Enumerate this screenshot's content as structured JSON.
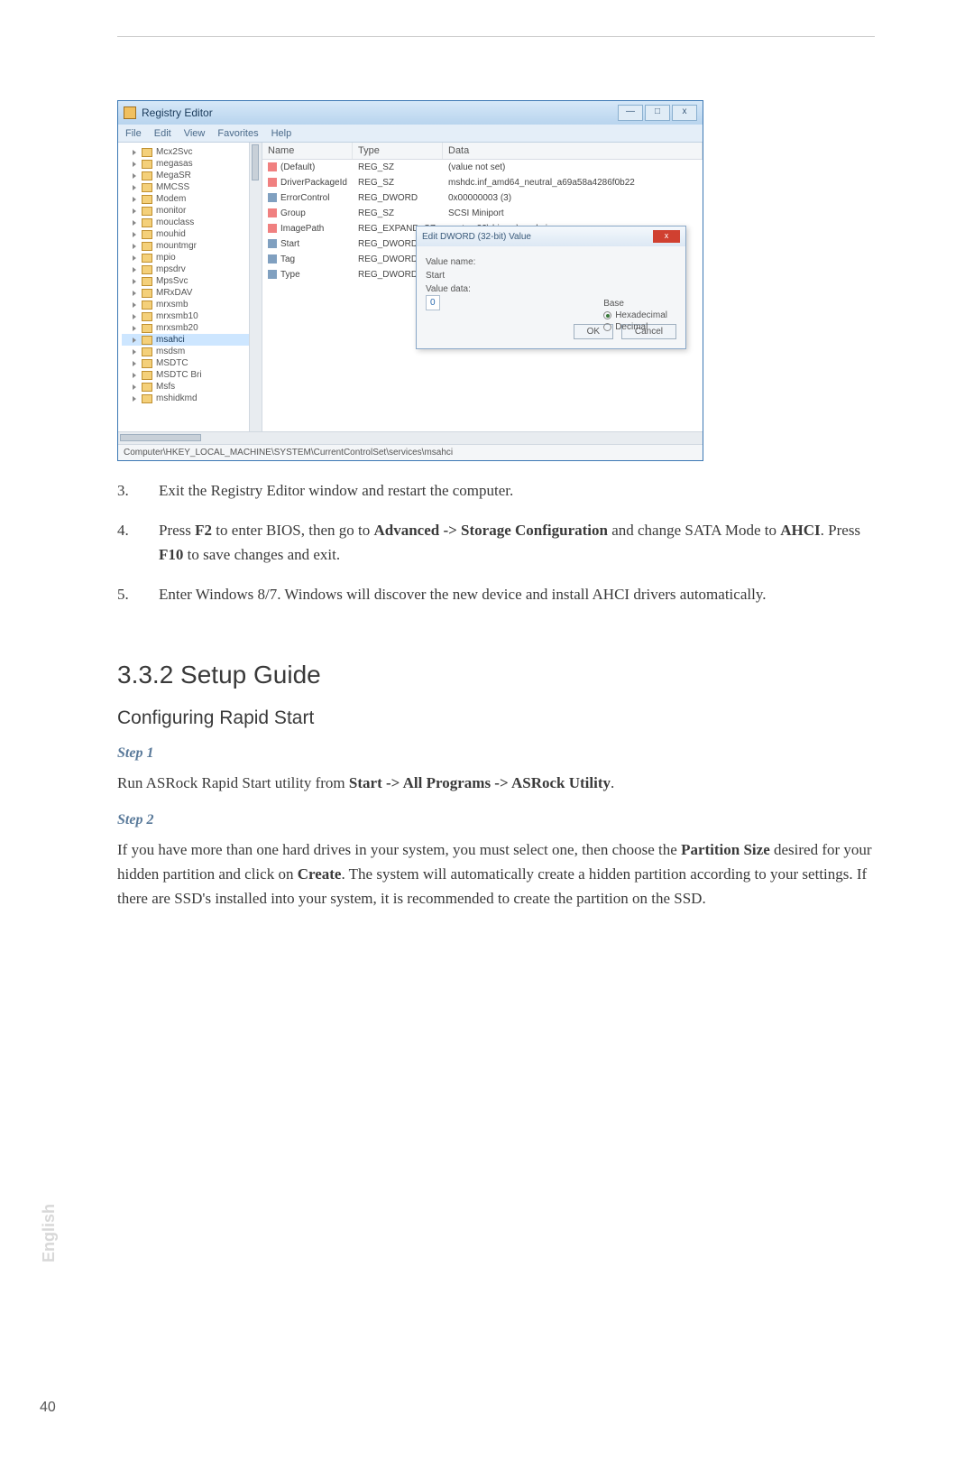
{
  "regedit": {
    "title": "Registry Editor",
    "menu": [
      "File",
      "Edit",
      "View",
      "Favorites",
      "Help"
    ],
    "win_btns": {
      "min": "—",
      "max": "□",
      "close": "x"
    },
    "tree": [
      "Mcx2Svc",
      "megasas",
      "MegaSR",
      "MMCSS",
      "Modem",
      "monitor",
      "mouclass",
      "mouhid",
      "mountmgr",
      "mpio",
      "mpsdrv",
      "MpsSvc",
      "MRxDAV",
      "mrxsmb",
      "mrxsmb10",
      "mrxsmb20",
      "msahci",
      "msdsm",
      "MSDTC",
      "MSDTC Bri",
      "Msfs",
      "mshidkmd"
    ],
    "tree_selected": "msahci",
    "columns": {
      "name": "Name",
      "type": "Type",
      "data": "Data"
    },
    "rows": [
      {
        "icon": "str",
        "name": "(Default)",
        "type": "REG_SZ",
        "data": "(value not set)"
      },
      {
        "icon": "str",
        "name": "DriverPackageId",
        "type": "REG_SZ",
        "data": "mshdc.inf_amd64_neutral_a69a58a4286f0b22"
      },
      {
        "icon": "bin",
        "name": "ErrorControl",
        "type": "REG_DWORD",
        "data": "0x00000003 (3)"
      },
      {
        "icon": "str",
        "name": "Group",
        "type": "REG_SZ",
        "data": "SCSI Miniport"
      },
      {
        "icon": "str",
        "name": "ImagePath",
        "type": "REG_EXPAND_SZ",
        "data": "system32\\drivers\\msahci.sys"
      },
      {
        "icon": "bin",
        "name": "Start",
        "type": "REG_DWORD",
        "data": ""
      },
      {
        "icon": "bin",
        "name": "Tag",
        "type": "REG_DWORD",
        "data": ""
      },
      {
        "icon": "bin",
        "name": "Type",
        "type": "REG_DWORD",
        "data": ""
      }
    ],
    "dialog": {
      "title": "Edit DWORD (32-bit) Value",
      "value_name_label": "Value name:",
      "value_name": "Start",
      "value_data_label": "Value data:",
      "value_data": "0",
      "base_label": "Base",
      "hex": "Hexadecimal",
      "dec": "Decimal",
      "ok": "OK",
      "cancel": "Cancel"
    },
    "status": "Computer\\HKEY_LOCAL_MACHINE\\SYSTEM\\CurrentControlSet\\services\\msahci"
  },
  "steps_list": [
    {
      "n": "3.",
      "parts": [
        "Exit the Registry Editor window and restart the computer."
      ]
    },
    {
      "n": "4.",
      "parts": [
        "Press ",
        {
          "b": "F2"
        },
        " to enter BIOS, then go to ",
        {
          "b": "Advanced -> Storage Configuration"
        },
        " and change SATA Mode to ",
        {
          "b": "AHCI"
        },
        ". Press ",
        {
          "b": "F10"
        },
        " to save changes and exit."
      ]
    },
    {
      "n": "5.",
      "parts": [
        "Enter Windows 8/7. Windows will discover the new device and install AHCI drivers automatically."
      ]
    }
  ],
  "section_heading": "3.3.2  Setup Guide",
  "sub_heading": "Configuring Rapid Start",
  "step1_label": "Step 1",
  "step1_parts": [
    "Run ASRock Rapid Start utility from ",
    {
      "b": "Start -> All Programs -> ASRock Utility"
    },
    "."
  ],
  "step2_label": "Step 2",
  "step2_parts": [
    "If you have more than one hard drives in your system, you must select one, then choose the ",
    {
      "b": "Partition Size"
    },
    " desired for your hidden partition and click on ",
    {
      "b": "Create"
    },
    ". The system will automatically create a hidden partition according to your settings. If there are SSD's installed into your system, it is recommended to create the partition on the SSD."
  ],
  "lang": "English",
  "page": "40"
}
